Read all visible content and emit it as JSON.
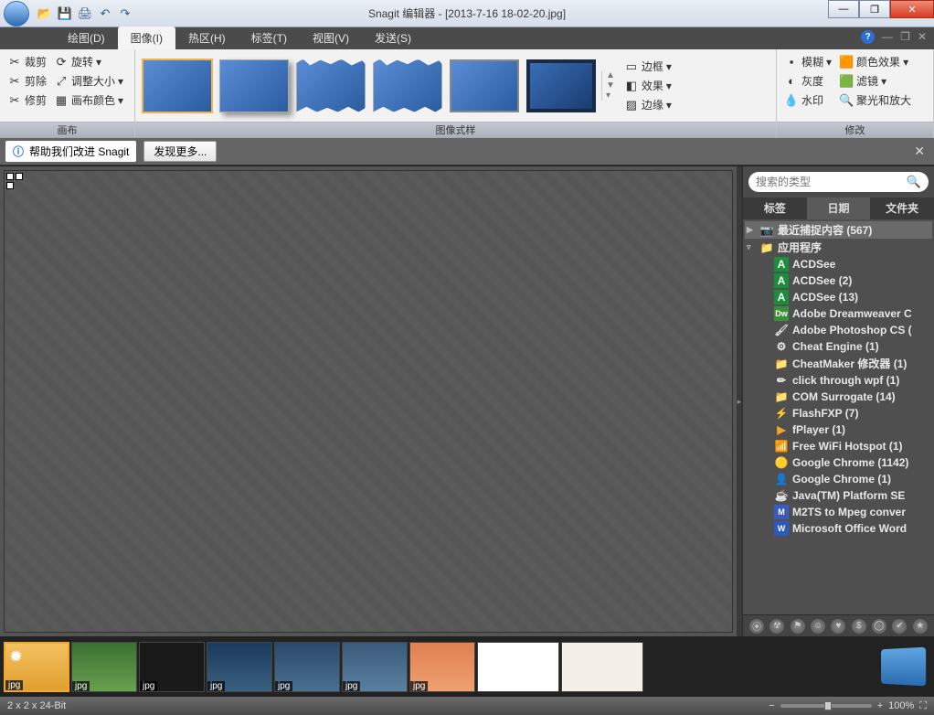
{
  "title": "Snagit 编辑器 - [2013-7-16 18-02-20.jpg]",
  "menu": {
    "draw": "绘图(D)",
    "image": "图像(I)",
    "hotspot": "热区(H)",
    "tags": "标签(T)",
    "view": "视图(V)",
    "send": "发送(S)"
  },
  "ribbon": {
    "group_canvas": "画布",
    "group_styles": "图像式样",
    "group_modify": "修改",
    "crop": "裁剪",
    "rotate": "旋转",
    "cut": "剪除",
    "resize": "调整大小",
    "trim": "修剪",
    "canvas_color": "画布颜色",
    "border": "边框",
    "effects": "效果",
    "edges": "边缘",
    "blur": "模糊",
    "gray": "灰度",
    "watermark": "水印",
    "coloreffect": "颜色效果",
    "filter": "滤镜",
    "spotlight": "聚光和放大"
  },
  "info": {
    "text": "帮助我们改进 Snagit",
    "button": "发现更多..."
  },
  "side": {
    "search_placeholder": "搜索的类型",
    "tab_tags": "标签",
    "tab_date": "日期",
    "tab_folder": "文件夹",
    "recent": "最近捕捉内容 (567)",
    "apps": "应用程序",
    "items": [
      "ACDSee",
      "ACDSee (2)",
      "ACDSee (13)",
      "Adobe Dreamweaver C",
      "Adobe Photoshop CS (",
      "Cheat Engine (1)",
      "CheatMaker 修改器 (1)",
      "click through wpf (1)",
      "COM Surrogate (14)",
      "FlashFXP (7)",
      "fPlayer (1)",
      "Free WiFi Hotspot (1)",
      "Google Chrome (1142)",
      "Google Chrome (1)",
      "Java(TM) Platform SE",
      "M2TS to Mpeg conver",
      "Microsoft Office Word"
    ]
  },
  "tray": [
    "jpg",
    "jpg",
    "jpg",
    "jpg",
    "jpg",
    "jpg",
    "jpg"
  ],
  "status": {
    "left": "2 x 2 x 24-Bit",
    "zoom": "100%"
  }
}
